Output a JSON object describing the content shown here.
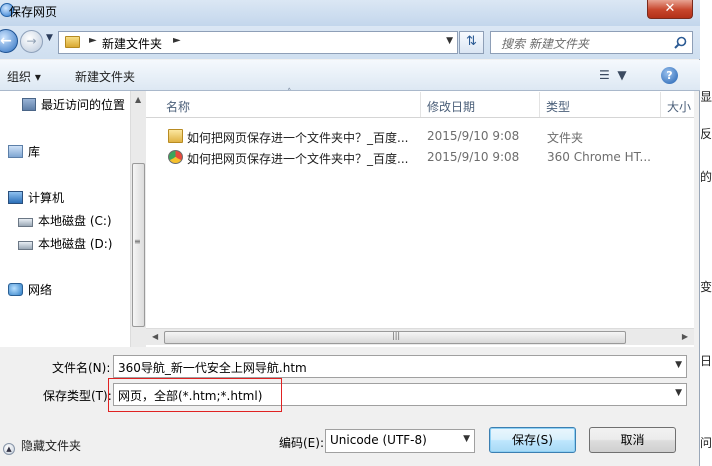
{
  "window": {
    "title": "保存网页",
    "close_label": "✕"
  },
  "nav": {
    "address_path": [
      "新建文件夹"
    ],
    "search_placeholder": "搜索 新建文件夹"
  },
  "toolbar": {
    "organize_label": "组织 ▾",
    "new_folder_label": "新建文件夹"
  },
  "sidebar": {
    "items": [
      {
        "label": "最近访问的位置",
        "icon": "recent-places-icon"
      },
      {
        "label": "库",
        "icon": "library-icon"
      },
      {
        "label": "计算机",
        "icon": "computer-icon"
      },
      {
        "label": "本地磁盘 (C:)",
        "icon": "drive-icon"
      },
      {
        "label": "本地磁盘 (D:)",
        "icon": "drive-icon"
      },
      {
        "label": "网络",
        "icon": "network-icon"
      }
    ]
  },
  "file_list": {
    "columns": [
      "名称",
      "修改日期",
      "类型",
      "大小"
    ],
    "rows": [
      {
        "name": "如何把网页保存进一个文件夹中？_百度...",
        "date": "2015/9/10 9:08",
        "type": "文件夹",
        "icon": "folder-icon"
      },
      {
        "name": "如何把网页保存进一个文件夹中？_百度...",
        "date": "2015/9/10 9:08",
        "type": "360 Chrome HT...",
        "icon": "chrome-html-icon"
      }
    ]
  },
  "form": {
    "filename_label": "文件名(N):",
    "filename_value": "360导航_新一代安全上网导航.htm",
    "filetype_label": "保存类型(T):",
    "filetype_value": "网页，全部(*.htm;*.html)",
    "encoding_label": "编码(E):",
    "encoding_value": "Unicode (UTF-8)",
    "hide_folders_label": "隐藏文件夹",
    "save_label": "保存(S)",
    "cancel_label": "取消"
  },
  "background_window": {
    "fragments": [
      "显",
      "反",
      "的",
      "变",
      "日",
      "问"
    ]
  },
  "colors": {
    "highlight": "#e02222",
    "titlebar": "#c3d6ec",
    "close": "#c7452b"
  }
}
